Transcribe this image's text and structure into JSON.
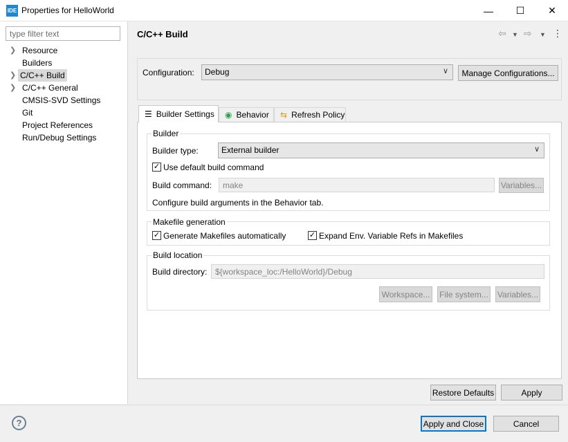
{
  "window": {
    "app_icon": "IDE",
    "title": "Properties for HelloWorld",
    "minimize": "—",
    "maximize": "☐",
    "close": "✕"
  },
  "sidebar": {
    "filter_placeholder": "type filter text",
    "items": [
      {
        "label": "Resource",
        "expandable": true
      },
      {
        "label": "Builders",
        "expandable": false
      },
      {
        "label": "C/C++ Build",
        "expandable": true,
        "selected": true
      },
      {
        "label": "C/C++ General",
        "expandable": true
      },
      {
        "label": "CMSIS-SVD Settings",
        "expandable": false
      },
      {
        "label": "Git",
        "expandable": false
      },
      {
        "label": "Project References",
        "expandable": false
      },
      {
        "label": "Run/Debug Settings",
        "expandable": false
      }
    ]
  },
  "page": {
    "title": "C/C++ Build",
    "nav_icons": [
      "back-arrow-icon",
      "back-dropdown-icon",
      "forward-arrow-icon",
      "forward-dropdown-icon",
      "view-menu-icon"
    ]
  },
  "configuration": {
    "label": "Configuration:",
    "value": "Debug",
    "manage_button": "Manage Configurations..."
  },
  "tabs": [
    {
      "label": "Builder Settings",
      "icon": "document-list-icon",
      "active": true
    },
    {
      "label": "Behavior",
      "icon": "radio-target-icon",
      "active": false
    },
    {
      "label": "Refresh Policy",
      "icon": "refresh-arrows-icon",
      "active": false
    }
  ],
  "builder": {
    "group_title": "Builder",
    "type_label": "Builder type:",
    "type_value": "External builder",
    "use_default_label": "Use default build command",
    "use_default_checked": true,
    "command_label": "Build command:",
    "command_value": "make",
    "variables_button": "Variables...",
    "hint": "Configure build arguments in the Behavior tab."
  },
  "makefile": {
    "group_title": "Makefile generation",
    "generate_label": "Generate Makefiles automatically",
    "generate_checked": true,
    "expand_label": "Expand Env. Variable Refs in Makefiles",
    "expand_checked": true
  },
  "build_location": {
    "group_title": "Build location",
    "directory_label": "Build directory:",
    "directory_value": "${workspace_loc:/HelloWorld}/Debug",
    "workspace_button": "Workspace...",
    "filesystem_button": "File system...",
    "variables_button": "Variables..."
  },
  "page_buttons": {
    "restore_defaults": "Restore Defaults",
    "apply": "Apply"
  },
  "dialog_buttons": {
    "help_icon_glyph": "?",
    "apply_and_close": "Apply and Close",
    "cancel": "Cancel"
  },
  "colors": {
    "accent": "#0078d7",
    "selection": "#d9d9d9",
    "app_icon": "#1e88d6"
  }
}
